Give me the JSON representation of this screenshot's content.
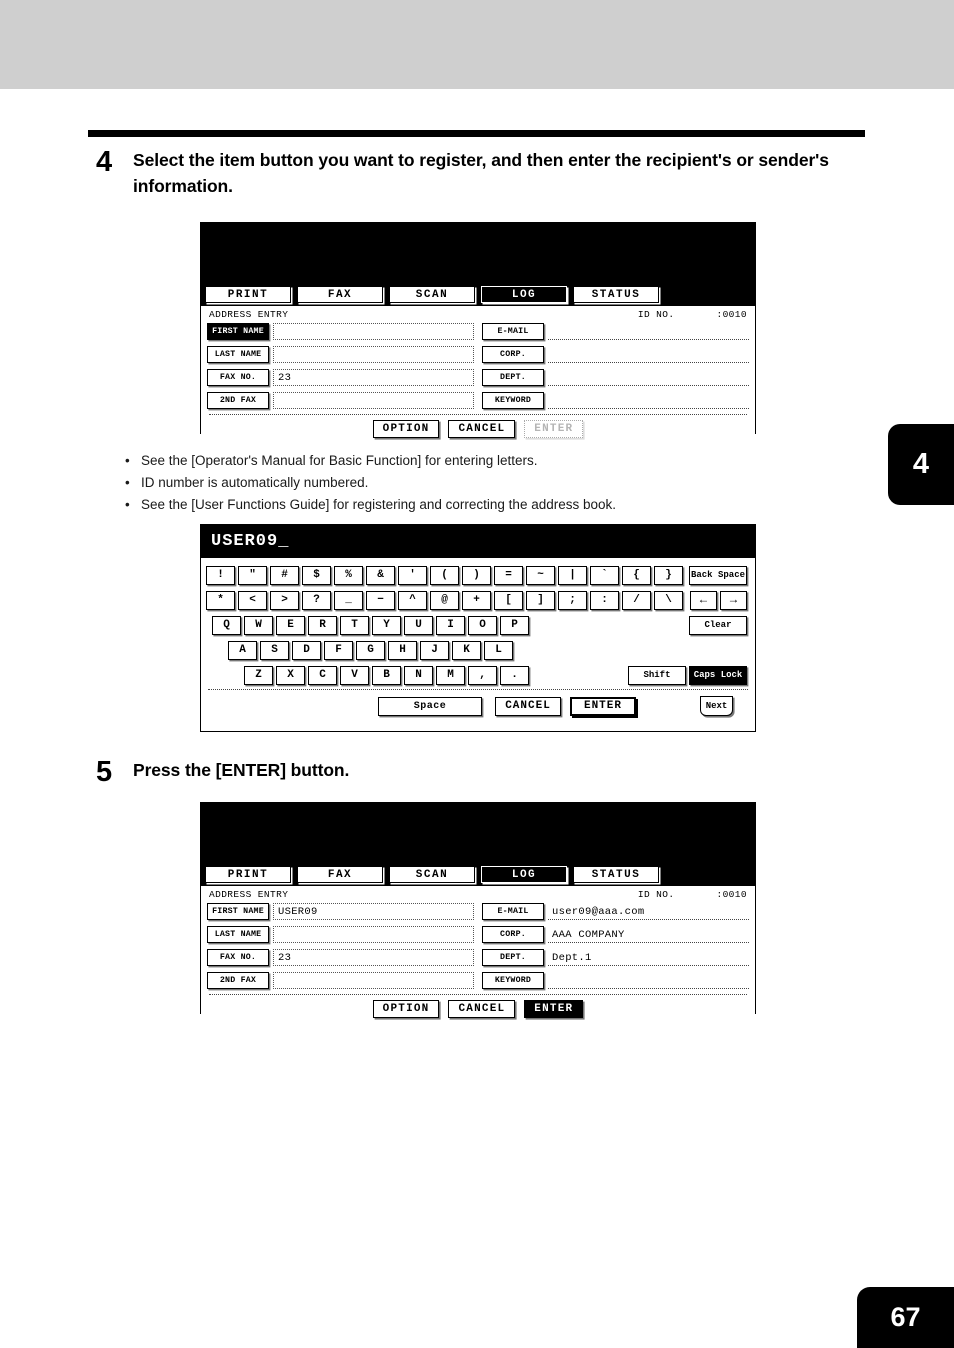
{
  "page": {
    "number": "67",
    "chapter_tab": "4"
  },
  "steps": [
    {
      "number": "4",
      "text": "Select the item button you want to register, and then enter the recipient's or sender's information."
    },
    {
      "number": "5",
      "text": "Press the [ENTER] button."
    }
  ],
  "notes": [
    "See the [Operator's Manual for Basic Function] for entering letters.",
    "ID number is automatically numbered.",
    "See the [User Functions Guide] for registering and correcting the address book."
  ],
  "bullet_char": "•",
  "address_entry_empty": {
    "tabs": [
      {
        "label": "PRINT",
        "selected": false
      },
      {
        "label": "FAX",
        "selected": false
      },
      {
        "label": "SCAN",
        "selected": false
      },
      {
        "label": "LOG",
        "selected": true
      },
      {
        "label": "STATUS",
        "selected": false
      }
    ],
    "title": "ADDRESS ENTRY",
    "id_label": "ID NO.",
    "id_value": ":0010",
    "left_fields": [
      {
        "key": "FIRST NAME",
        "value": "",
        "selected": true
      },
      {
        "key": "LAST NAME",
        "value": "",
        "selected": false
      },
      {
        "key": "FAX NO.",
        "value": "23",
        "selected": false
      },
      {
        "key": "2ND FAX",
        "value": "",
        "selected": false
      }
    ],
    "right_fields": [
      {
        "key": "E-MAIL",
        "value": "",
        "selected": false
      },
      {
        "key": "CORP.",
        "value": "",
        "selected": false
      },
      {
        "key": "DEPT.",
        "value": "",
        "selected": false
      },
      {
        "key": "KEYWORD",
        "value": "",
        "selected": false
      }
    ],
    "buttons": [
      {
        "label": "OPTION",
        "state": "normal"
      },
      {
        "label": "CANCEL",
        "state": "normal"
      },
      {
        "label": "ENTER",
        "state": "disabled"
      }
    ]
  },
  "address_entry_filled": {
    "tabs": [
      {
        "label": "PRINT",
        "selected": false
      },
      {
        "label": "FAX",
        "selected": false
      },
      {
        "label": "SCAN",
        "selected": false
      },
      {
        "label": "LOG",
        "selected": true
      },
      {
        "label": "STATUS",
        "selected": false
      }
    ],
    "title": "ADDRESS ENTRY",
    "id_label": "ID NO.",
    "id_value": ":0010",
    "left_fields": [
      {
        "key": "FIRST NAME",
        "value": "USER09",
        "selected": false
      },
      {
        "key": "LAST NAME",
        "value": "",
        "selected": false
      },
      {
        "key": "FAX NO.",
        "value": "23",
        "selected": false
      },
      {
        "key": "2ND FAX",
        "value": "",
        "selected": false
      }
    ],
    "right_fields": [
      {
        "key": "E-MAIL",
        "value": "user09@aaa.com",
        "selected": false
      },
      {
        "key": "CORP.",
        "value": "AAA COMPANY",
        "selected": false
      },
      {
        "key": "DEPT.",
        "value": "Dept.1",
        "selected": false
      },
      {
        "key": "KEYWORD",
        "value": "",
        "selected": false
      }
    ],
    "buttons": [
      {
        "label": "OPTION",
        "state": "normal"
      },
      {
        "label": "CANCEL",
        "state": "normal"
      },
      {
        "label": "ENTER",
        "state": "selected"
      }
    ]
  },
  "keyboard": {
    "display_value": "USER09_",
    "row1": [
      "!",
      "\"",
      "#",
      "$",
      "%",
      "&",
      "'",
      "(",
      ")",
      "=",
      "~",
      "|",
      "`",
      "{",
      "}"
    ],
    "row1_right": [
      {
        "label": "Back Space",
        "type": "wide"
      }
    ],
    "row2": [
      "*",
      "<",
      ">",
      "?",
      "_",
      "−",
      "^",
      "@",
      "+",
      "[",
      "]",
      ";",
      ":",
      "/",
      "\\"
    ],
    "row2_right": [
      {
        "label": "←",
        "type": "arrow"
      },
      {
        "label": "→",
        "type": "arrow"
      }
    ],
    "row3": [
      "Q",
      "W",
      "E",
      "R",
      "T",
      "Y",
      "U",
      "I",
      "O",
      "P"
    ],
    "row3_right": [
      {
        "label": "Clear",
        "type": "wide"
      }
    ],
    "row4": [
      "A",
      "S",
      "D",
      "F",
      "G",
      "H",
      "J",
      "K",
      "L"
    ],
    "row5": [
      "Z",
      "X",
      "C",
      "V",
      "B",
      "N",
      "M",
      ",",
      "."
    ],
    "row5_right": [
      {
        "label": "Shift",
        "type": "wide",
        "selected": false
      },
      {
        "label": "Caps Lock",
        "type": "wide",
        "selected": true
      }
    ],
    "footer": [
      {
        "label": "Space",
        "type": "space"
      },
      {
        "label": "CANCEL",
        "type": "act"
      },
      {
        "label": "ENTER",
        "type": "act-bold"
      }
    ],
    "next_label": "Next"
  }
}
